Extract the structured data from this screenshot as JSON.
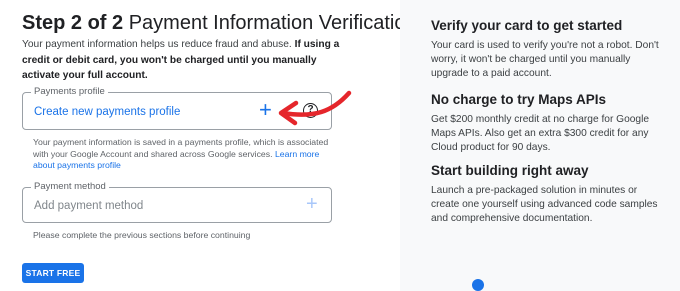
{
  "form": {
    "step_label": "Step 2 of 2",
    "title_text": " Payment Information Verification",
    "intro_plain": "Your payment information helps us reduce fraud and abuse. ",
    "intro_bold": "If using a credit or debit card, you won't be charged until you manually activate your full account.",
    "payments_profile": {
      "legend": "Payments profile",
      "value": "Create new payments profile",
      "add_icon": "plus-icon",
      "help_icon": "help-circle-icon"
    },
    "profile_note_text": "Your payment information is saved in a payments profile, which is associated with your Google Account and shared across Google services. ",
    "profile_note_link": "Learn more about payments profile",
    "payment_method": {
      "legend": "Payment method",
      "placeholder": "Add payment method",
      "add_icon": "plus-icon"
    },
    "method_note": "Please complete the previous sections before continuing",
    "start_button": "START FREE"
  },
  "benefits": [
    {
      "heading": "Verify your card to get started",
      "body": "Your card is used to verify you're not a robot. Don't worry, it won't be charged until you manually upgrade to a paid account."
    },
    {
      "heading": "No charge to try Maps APIs",
      "body": "Get $200 monthly credit at no charge for Google Maps APIs. Also get an extra $300 credit for any Cloud product for 90 days."
    },
    {
      "heading": "Start building right away",
      "body": "Launch a pre-packaged solution in minutes or create one yourself using advanced code samples and comprehensive documentation."
    }
  ],
  "colors": {
    "accent": "#1a73e8",
    "annotation_arrow": "#e5262b",
    "panel_bg": "#f8f9fa"
  }
}
